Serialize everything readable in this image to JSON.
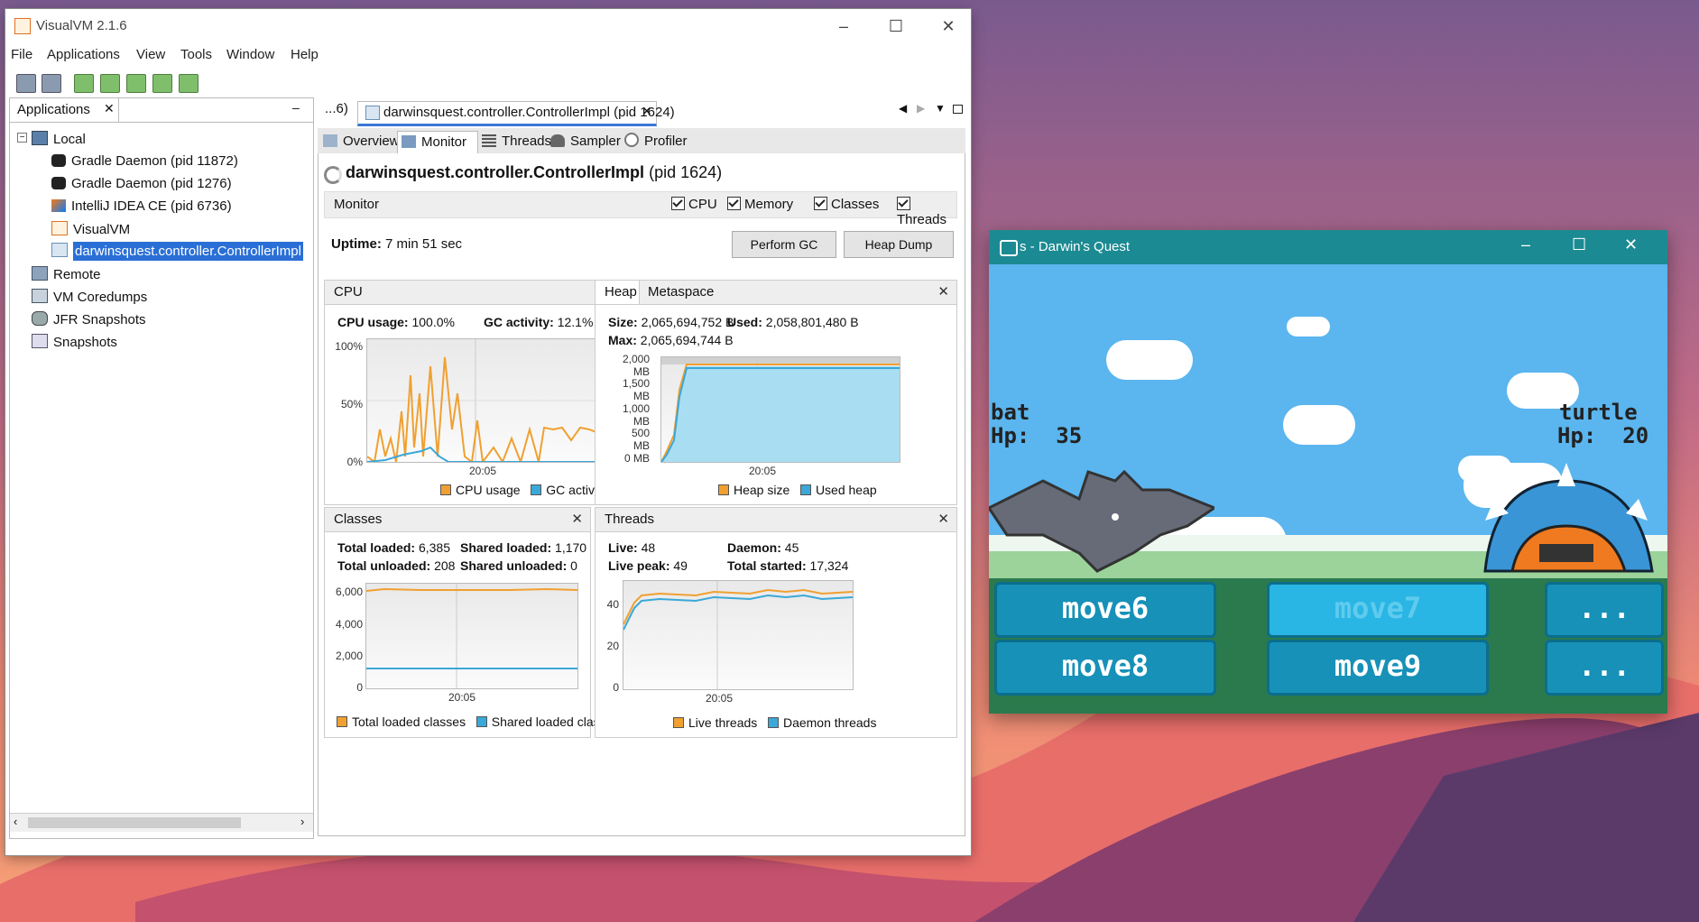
{
  "colors": {
    "accent_orange": "#f0a030",
    "accent_blue": "#3aa8d8",
    "selection": "#2a6fd6",
    "teal": "#1c8a92"
  },
  "visualvm": {
    "title": "VisualVM 2.1.6",
    "menu": [
      "File",
      "Applications",
      "View",
      "Tools",
      "Window",
      "Help"
    ],
    "apps_tab": "Applications",
    "tree": {
      "local": "Local",
      "items": [
        "Gradle Daemon (pid 11872)",
        "Gradle Daemon (pid 1276)",
        "IntelliJ IDEA CE (pid 6736)",
        "VisualVM",
        "darwinsquest.controller.ControllerImpl"
      ],
      "remote": "Remote",
      "vm_coredumps": "VM Coredumps",
      "jfr_snapshots": "JFR Snapshots",
      "snapshots": "Snapshots"
    },
    "doc_tabs": {
      "prev": "...6)",
      "active": "darwinsquest.controller.ControllerImpl (pid 1624)"
    },
    "sub_tabs": [
      "Overview",
      "Monitor",
      "Threads",
      "Sampler",
      "Profiler"
    ],
    "process_title": "darwinsquest.controller.ControllerImpl",
    "process_pid": "(pid 1624)",
    "monitor": {
      "label": "Monitor",
      "checks": [
        "CPU",
        "Memory",
        "Classes",
        "Threads"
      ],
      "uptime_label": "Uptime:",
      "uptime_value": "7 min 51 sec",
      "perform_gc": "Perform GC",
      "heap_dump": "Heap Dump"
    },
    "cpu": {
      "title": "CPU",
      "usage_label": "CPU usage:",
      "usage_value": "100.0%",
      "gc_label": "GC activity:",
      "gc_value": "12.1%",
      "y_ticks": [
        "100%",
        "50%",
        "0%"
      ],
      "x_tick": "20:05",
      "legend": [
        "CPU usage",
        "GC activity"
      ]
    },
    "heap": {
      "tab_active": "Heap",
      "tab_other": "Metaspace",
      "size_label": "Size:",
      "size_value": "2,065,694,752 B",
      "used_label": "Used:",
      "used_value": "2,058,801,480 B",
      "max_label": "Max:",
      "max_value": "2,065,694,744 B",
      "y_ticks": [
        "2,000 MB",
        "1,500 MB",
        "1,000 MB",
        "500 MB",
        "0 MB"
      ],
      "x_tick": "20:05",
      "legend": [
        "Heap size",
        "Used heap"
      ]
    },
    "classes": {
      "title": "Classes",
      "total_loaded_label": "Total loaded:",
      "total_loaded_value": "6,385",
      "shared_loaded_label": "Shared loaded:",
      "shared_loaded_value": "1,170",
      "total_unloaded_label": "Total unloaded:",
      "total_unloaded_value": "208",
      "shared_unloaded_label": "Shared unloaded:",
      "shared_unloaded_value": "0",
      "y_ticks": [
        "6,000",
        "4,000",
        "2,000",
        "0"
      ],
      "x_tick": "20:05",
      "legend": [
        "Total loaded classes",
        "Shared loaded classes"
      ]
    },
    "threads": {
      "title": "Threads",
      "live_label": "Live:",
      "live_value": "48",
      "daemon_label": "Daemon:",
      "daemon_value": "45",
      "peak_label": "Live peak:",
      "peak_value": "49",
      "started_label": "Total started:",
      "started_value": "17,324",
      "y_ticks": [
        "40",
        "20",
        "0"
      ],
      "x_tick": "20:05",
      "legend": [
        "Live threads",
        "Daemon threads"
      ]
    }
  },
  "darwins_quest": {
    "title": "s - Darwin's Quest",
    "left_name": "bat",
    "left_hp": "Hp:  35",
    "right_name": "turtle",
    "right_hp": "Hp:  20",
    "moves": [
      "move6",
      "move7",
      "...",
      "move8",
      "move9",
      "..."
    ]
  }
}
